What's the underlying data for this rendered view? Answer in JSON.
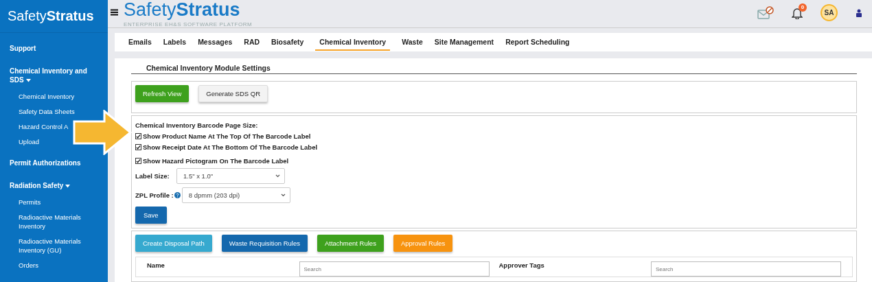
{
  "sidebar": {
    "logo": {
      "light": "Safety",
      "bold": "Stratus"
    },
    "items": [
      {
        "kind": "section",
        "label": "Support",
        "expanded": false
      },
      {
        "kind": "section",
        "label": "Chemical Inventory and SDS",
        "expanded": true
      },
      {
        "kind": "item",
        "label": "Chemical Inventory"
      },
      {
        "kind": "item",
        "label": "Safety Data Sheets"
      },
      {
        "kind": "item",
        "label": "Hazard Control A"
      },
      {
        "kind": "item",
        "label": "Upload"
      },
      {
        "kind": "section",
        "label": "Permit Authorizations",
        "expanded": false
      },
      {
        "kind": "section",
        "label": "Radiation Safety",
        "expanded": true
      },
      {
        "kind": "item",
        "label": "Permits"
      },
      {
        "kind": "item",
        "label": "Radioactive Materials Inventory"
      },
      {
        "kind": "item",
        "label": "Radioactive Materials Inventory (GU)"
      },
      {
        "kind": "item",
        "label": "Orders"
      }
    ]
  },
  "header": {
    "logo": {
      "light": "Safety",
      "bold": "Stratus"
    },
    "tagline": "ENTERPRISE EH&S SOFTWARE PLATFORM",
    "notification_count": "0",
    "avatar": "SA"
  },
  "tabs": [
    {
      "label": "Emails",
      "selected": false
    },
    {
      "label": "Labels",
      "selected": false
    },
    {
      "label": "Messages",
      "selected": false
    },
    {
      "label": "RAD",
      "selected": false
    },
    {
      "label": "Biosafety",
      "selected": false
    },
    {
      "label": "Chemical Inventory",
      "selected": true
    },
    {
      "label": "Waste",
      "selected": false
    },
    {
      "label": "Site Management",
      "selected": false
    },
    {
      "label": "Report Scheduling",
      "selected": false
    }
  ],
  "settings": {
    "title": "Chemical Inventory Module Settings",
    "top_buttons": [
      {
        "label": "Refresh View",
        "kind": "success"
      },
      {
        "label": "Generate SDS QR",
        "kind": "default"
      }
    ],
    "barcode_title": "Chemical Inventory Barcode Page Size:",
    "options": [
      {
        "label": "Show Product Name At The Top Of The Barcode Label",
        "checked": true
      },
      {
        "label": "Show Receipt Date At The Bottom Of The Barcode Label",
        "checked": true
      },
      {
        "label": "Show Hazard Pictogram On The Barcode Label",
        "checked": true
      }
    ],
    "label_size": {
      "label": "Label Size:",
      "value": "1.5\" x 1.0\""
    },
    "zpl_profile": {
      "label": "ZPL Profile :",
      "value": "8 dpmm (203 dpi)"
    },
    "save": "Save",
    "rule_buttons": [
      {
        "label": "Create Disposal Path",
        "kind": "info"
      },
      {
        "label": "Waste Requisition Rules",
        "kind": "primary"
      },
      {
        "label": "Attachment Rules",
        "kind": "success"
      },
      {
        "label": "Approval Rules",
        "kind": "warning"
      }
    ],
    "filters": [
      {
        "label": "Name",
        "placeholder": "Search"
      },
      {
        "label": "Approver Tags",
        "placeholder": "Search"
      }
    ]
  }
}
